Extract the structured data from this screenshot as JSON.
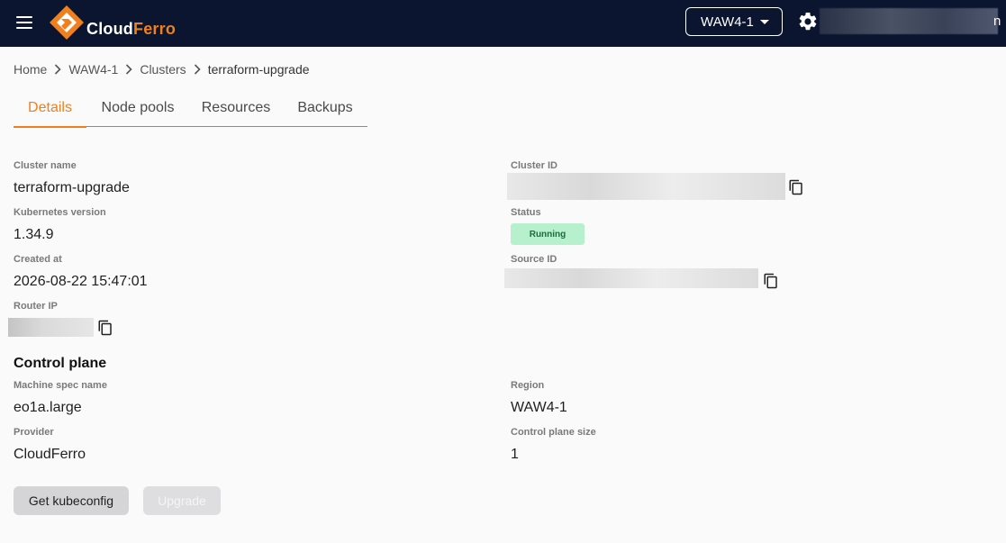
{
  "header": {
    "logo_text_a": "Cloud",
    "logo_text_b": "Ferro",
    "region": "WAW4-1",
    "user_tail": "n"
  },
  "breadcrumb": [
    "Home",
    "WAW4-1",
    "Clusters",
    "terraform-upgrade"
  ],
  "tabs": [
    {
      "label": "Details",
      "active": true
    },
    {
      "label": "Node pools",
      "active": false
    },
    {
      "label": "Resources",
      "active": false
    },
    {
      "label": "Backups",
      "active": false
    }
  ],
  "details": {
    "cluster_name_label": "Cluster name",
    "cluster_name": "terraform-upgrade",
    "k8s_version_label": "Kubernetes version",
    "k8s_version": "1.34.9",
    "created_at_label": "Created at",
    "created_at": "2026-08-22 15:47:01",
    "router_ip_label": "Router IP",
    "cluster_id_label": "Cluster ID",
    "status_label": "Status",
    "status": "Running",
    "source_id_label": "Source ID"
  },
  "control_plane": {
    "title": "Control plane",
    "machine_spec_label": "Machine spec name",
    "machine_spec": "eo1a.large",
    "provider_label": "Provider",
    "provider": "CloudFerro",
    "region_label": "Region",
    "region": "WAW4-1",
    "size_label": "Control plane size",
    "size": "1"
  },
  "actions": {
    "kubeconfig": "Get kubeconfig",
    "upgrade": "Upgrade"
  },
  "colors": {
    "topbar": "#0b1530",
    "accent": "#f07f1d",
    "status_bg": "#b6f0cc",
    "status_text": "#1e6b3c"
  }
}
